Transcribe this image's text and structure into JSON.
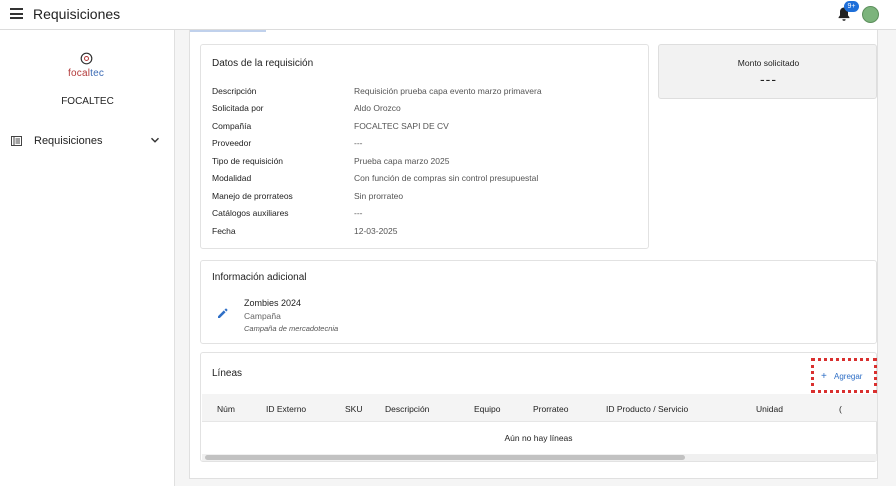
{
  "header": {
    "title": "Requisiciones",
    "notification_badge": "9+",
    "menu_icon": "hamburger-menu-icon",
    "bell_icon": "bell-icon",
    "avatar_icon": "user-avatar"
  },
  "sidebar": {
    "logo": {
      "text_part1": "focal",
      "text_part2": "tec",
      "icon": "focaltec-logo-icon"
    },
    "company": "FOCALTEC",
    "items": [
      {
        "label": "Requisiciones",
        "icon": "list-icon",
        "expand_icon": "chevron-down-icon"
      }
    ]
  },
  "requisicion": {
    "title": "Datos de la requisición",
    "rows": [
      {
        "label": "Descripción",
        "value": "Requisición prueba capa evento marzo primavera"
      },
      {
        "label": "Solicitada por",
        "value": "Aldo Orozco"
      },
      {
        "label": "Compañía",
        "value": "FOCALTEC SAPI DE CV"
      },
      {
        "label": "Proveedor",
        "value": "---"
      },
      {
        "label": "Tipo de requisición",
        "value": "Prueba capa marzo 2025"
      },
      {
        "label": "Modalidad",
        "value": "Con función de compras sin control presupuestal"
      },
      {
        "label": "Manejo de prorrateos",
        "value": "Sin prorrateo"
      },
      {
        "label": "Catálogos auxiliares",
        "value": "---"
      },
      {
        "label": "Fecha",
        "value": "12-03-2025"
      }
    ]
  },
  "monto": {
    "label": "Monto solicitado",
    "value": "---"
  },
  "info_adicional": {
    "title": "Información adicional",
    "name": "Zombies 2024",
    "type": "Campaña",
    "description": "Campaña de mercadotecnia",
    "edit_icon": "pencil-icon"
  },
  "lineas": {
    "title": "Líneas",
    "add_label": "Agregar",
    "add_icon": "plus-icon",
    "columns": [
      "Núm",
      "ID Externo",
      "SKU",
      "Descripción",
      "Equipo",
      "Prorrateo",
      "ID Producto / Servicio",
      "Unidad",
      "("
    ],
    "empty_message": "Aún no hay líneas"
  },
  "colors": {
    "accent": "#2f6fc6",
    "badge": "#1e6fd9",
    "highlight_dotted": "#d9302f"
  }
}
